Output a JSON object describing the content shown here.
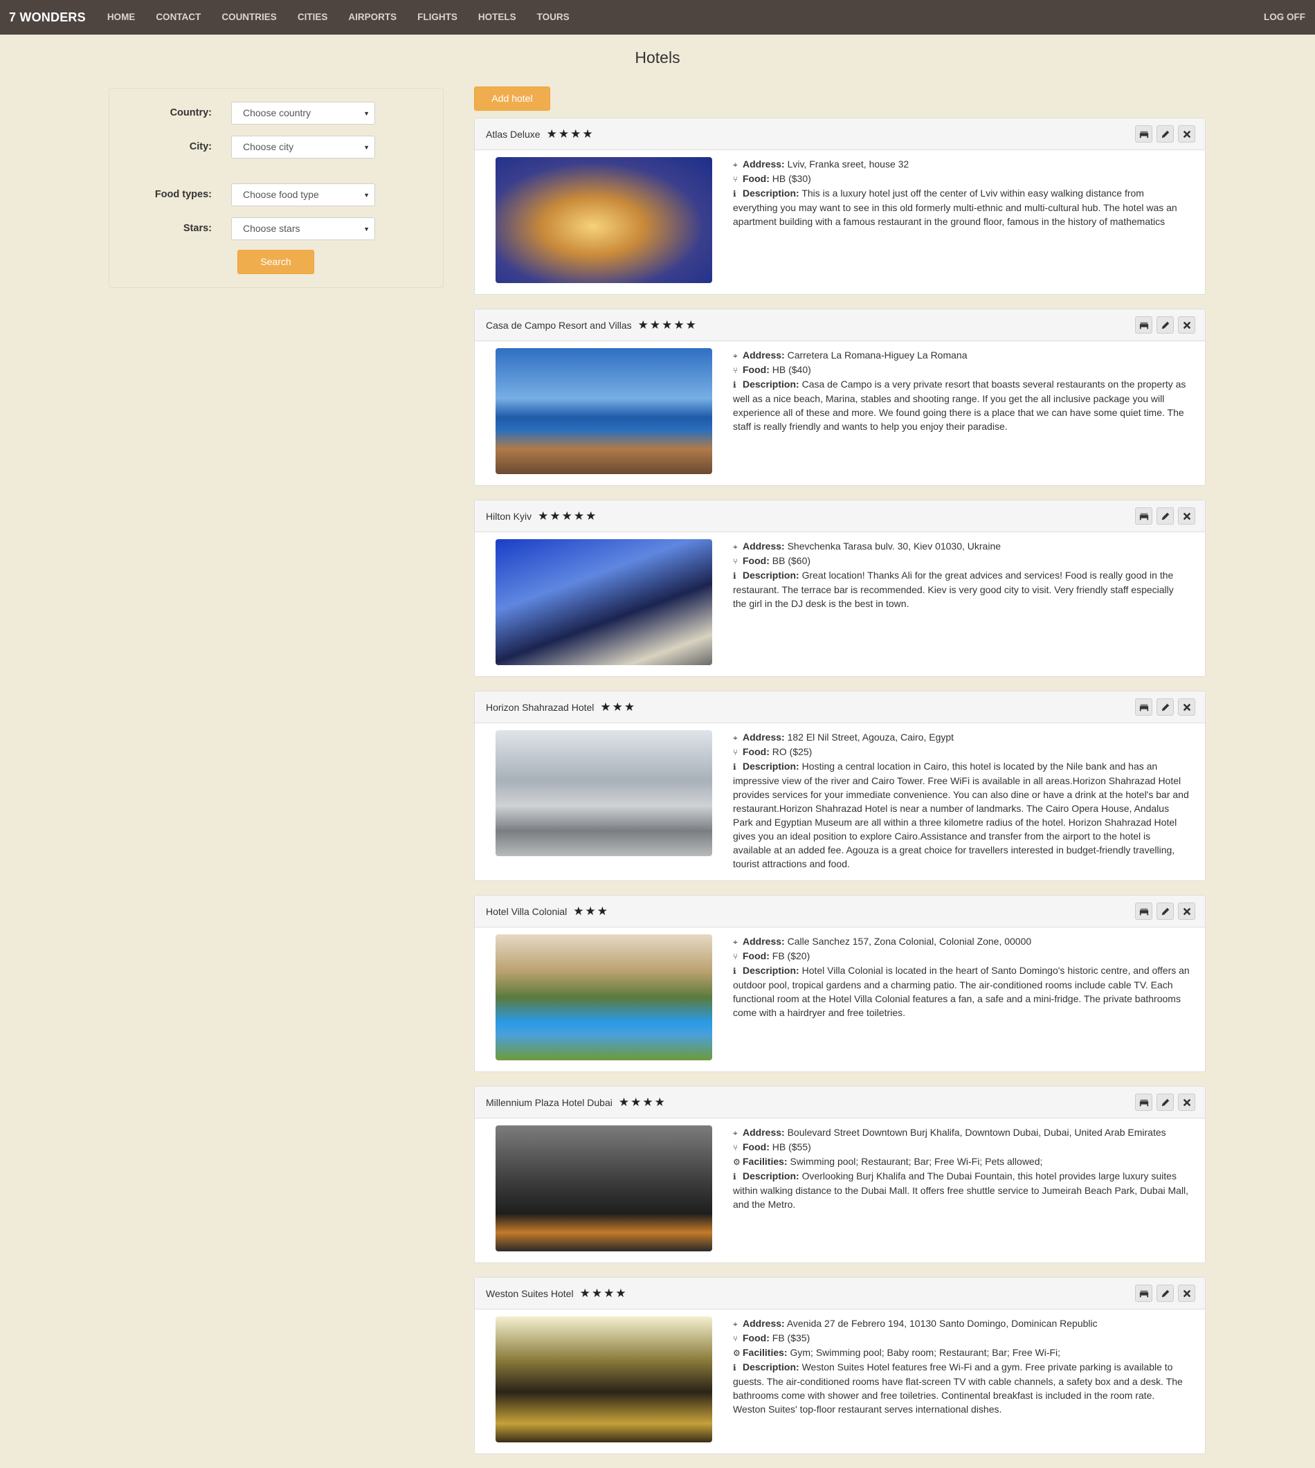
{
  "nav": {
    "brand": "7 WONDERS",
    "links": [
      "HOME",
      "CONTACT",
      "COUNTRIES",
      "CITIES",
      "AIRPORTS",
      "FLIGHTS",
      "HOTELS",
      "TOURS"
    ],
    "logoff": "LOG OFF"
  },
  "page_title": "Hotels",
  "filter": {
    "country_label": "Country:",
    "country_value": "Choose country",
    "city_label": "City:",
    "city_value": "Choose city",
    "food_label": "Food types:",
    "food_value": "Choose food type",
    "stars_label": "Stars:",
    "stars_value": "Choose stars",
    "search_label": "Search"
  },
  "add_hotel_label": "Add hotel",
  "labels": {
    "address": "Address:",
    "food": "Food:",
    "facilities": "Facilities:",
    "description": "Description:"
  },
  "hotels": [
    {
      "name": "Atlas Deluxe",
      "stars": "★★★★",
      "address": "Lviv, Franka sreet, house 32",
      "food": "HB ($30)",
      "facilities": "",
      "description": "This is a luxury hotel just off the center of Lviv within easy walking distance from everything you may want to see in this old formerly multi-ethnic and multi-cultural hub. The hotel was an apartment building with a famous restaurant in the ground floor, famous in the history of mathematics"
    },
    {
      "name": "Casa de Campo Resort and Villas",
      "stars": "★★★★★",
      "address": "Carretera La Romana-Higuey La Romana",
      "food": "HB ($40)",
      "facilities": "",
      "description": "Casa de Campo is a very private resort that boasts several restaurants on the property as well as a nice beach, Marina, stables and shooting range. If you get the all inclusive package you will experience all of these and more. We found going there is a place that we can have some quiet time. The staff is really friendly and wants to help you enjoy their paradise."
    },
    {
      "name": "Hilton Kyiv",
      "stars": "★★★★★",
      "address": "Shevchenka Tarasa bulv. 30, Kiev 01030, Ukraine",
      "food": "BB ($60)",
      "facilities": "",
      "description": "Great location! Thanks Ali for the great advices and services! Food is really good in the restaurant. The terrace bar is recommended. Kiev is very good city to visit. Very friendly staff especially the girl in the DJ desk is the best in town."
    },
    {
      "name": "Horizon Shahrazad Hotel",
      "stars": "★★★",
      "address": "182 El Nil Street, Agouza, Cairo, Egypt",
      "food": "RO ($25)",
      "facilities": "",
      "description": "Hosting a central location in Cairo, this hotel is located by the Nile bank and has an impressive view of the river and Cairo Tower. Free WiFi is available in all areas.Horizon Shahrazad Hotel provides services for your immediate convenience. You can also dine or have a drink at the hotel's bar and restaurant.Horizon Shahrazad Hotel is near a number of landmarks. The Cairo Opera House, Andalus Park and Egyptian Museum are all within a three kilometre radius of the hotel. Horizon Shahrazad Hotel gives you an ideal position to explore Cairo.Assistance and transfer from the airport to the hotel is available at an added fee. Agouza is a great choice for travellers interested in budget-friendly travelling, tourist attractions and food."
    },
    {
      "name": "Hotel Villa Colonial",
      "stars": "★★★",
      "address": "Calle Sanchez 157, Zona Colonial, Colonial Zone, 00000",
      "food": "FB ($20)",
      "facilities": "",
      "description": "Hotel Villa Colonial is located in the heart of Santo Domingo's historic centre, and offers an outdoor pool, tropical gardens and a charming patio. The air-conditioned rooms include cable TV. Each functional room at the Hotel Villa Colonial features a fan, a safe and a mini-fridge. The private bathrooms come with a hairdryer and free toiletries."
    },
    {
      "name": "Millennium Plaza Hotel Dubai",
      "stars": "★★★★",
      "address": "Boulevard Street Downtown Burj Khalifa, Downtown Dubai, Dubai, United Arab Emirates",
      "food": "HB ($55)",
      "facilities": "Swimming pool; Restaurant; Bar; Free Wi-Fi; Pets allowed;",
      "description": "Overlooking Burj Khalifa and The Dubai Fountain, this hotel provides large luxury suites within walking distance to the Dubai Mall. It offers free shuttle service to Jumeirah Beach Park, Dubai Mall, and the Metro."
    },
    {
      "name": "Weston Suites Hotel",
      "stars": "★★★★",
      "address": "Avenida 27 de Febrero 194, 10130 Santo Domingo, Dominican Republic",
      "food": "FB ($35)",
      "facilities": "Gym; Swimming pool; Baby room; Restaurant; Bar; Free Wi-Fi;",
      "description": "Weston Suites Hotel features free Wi-Fi and a gym. Free private parking is available to guests. The air-conditioned rooms have flat-screen TV with cable channels, a safety box and a desk. The bathrooms come with shower and free toiletries. Continental breakfast is included in the room rate. Weston Suites' top-floor restaurant serves international dishes."
    }
  ]
}
